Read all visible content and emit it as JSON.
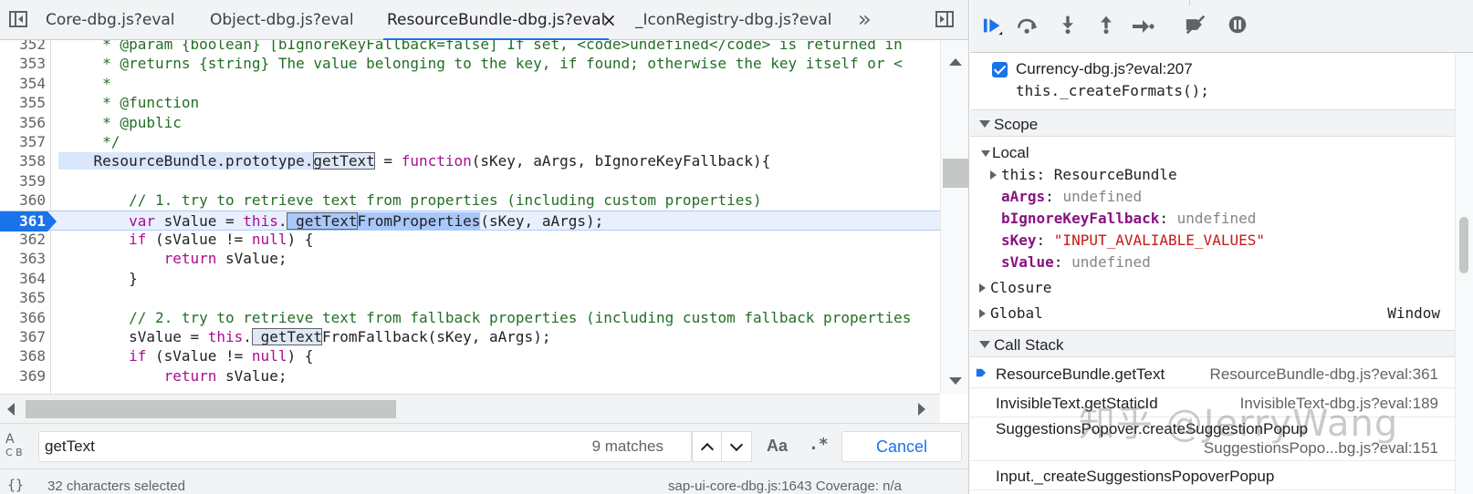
{
  "tabs": [
    {
      "label": "Core-dbg.js?eval"
    },
    {
      "label": "Object-dbg.js?eval"
    },
    {
      "label": "ResourceBundle-dbg.js?eval",
      "active": true
    },
    {
      "label": "_IconRegistry-dbg.js?eval"
    }
  ],
  "tabs_close_glyph": "×",
  "tabs_more_glyph": "»",
  "editor": {
    "current_line": 361,
    "lines": [
      {
        "n": "352",
        "text": "     * @param {boolean} [bIgnoreKeyFallback=false] If set, <code>undefined</code> is returned in"
      },
      {
        "n": "353",
        "text": "     * @returns {string} The value belonging to the key, if found; otherwise the key itself or <"
      },
      {
        "n": "354",
        "text": "     *"
      },
      {
        "n": "355",
        "text": "     * @function"
      },
      {
        "n": "356",
        "text": "     * @public"
      },
      {
        "n": "357",
        "text": "     */"
      },
      {
        "n": "358",
        "pre": "    ResourceBundle.prototype.",
        "match": "getText",
        "post": " = ",
        "kw": "function",
        "post2": "(sKey, aArgs, bIgnoreKeyFallback){"
      },
      {
        "n": "359",
        "text": ""
      },
      {
        "n": "360",
        "text": "        // 1. try to retrieve text from properties (including custom properties)"
      },
      {
        "n": "361",
        "kw": "var",
        "pre": " sValue = ",
        "kw2": "this",
        "dot": ".",
        "sel": "_getText",
        "sel2": "FromProperties",
        "post": "(sKey, aArgs);"
      },
      {
        "n": "362",
        "kw": "if",
        "pre": " (sValue != ",
        "kw2": "null",
        "post": ") {"
      },
      {
        "n": "363",
        "kw": "return",
        "post": " sValue;"
      },
      {
        "n": "364",
        "text": "        }"
      },
      {
        "n": "365",
        "text": ""
      },
      {
        "n": "366",
        "text": "        // 2. try to retrieve text from fallback properties (including custom fallback properties"
      },
      {
        "n": "367",
        "pre": "        sValue = ",
        "kw2": "this",
        "dot": ".",
        "match": "_getText",
        "post": "FromFallback(sKey, aArgs);"
      },
      {
        "n": "368",
        "kw": "if",
        "pre": " (sValue != ",
        "kw2": "null",
        "post": ") {"
      },
      {
        "n": "369",
        "kw": "return",
        "post": " sValue;"
      }
    ]
  },
  "search": {
    "value": "getText",
    "match_count": "9 matches",
    "match_case_label": "Aa",
    "regex_label": ".*",
    "cancel_label": "Cancel",
    "replace_toggle": "A",
    "replace_toggle_sub": "C B"
  },
  "status": {
    "pretty_print": "{}",
    "selection": "32 characters selected",
    "coverage": "sap-ui-core-dbg.js:1643  Coverage: n/a"
  },
  "debugger": {
    "breakpoint": {
      "checked": true,
      "location": "Currency-dbg.js?eval:207",
      "code": "this._createFormats();"
    },
    "scope": {
      "title": "Scope",
      "local_title": "Local",
      "this_label": "this: ResourceBundle",
      "vars": [
        {
          "name": "aArgs",
          "value": "undefined",
          "type": "undef"
        },
        {
          "name": "bIgnoreKeyFallback",
          "value": "undefined",
          "type": "undef"
        },
        {
          "name": "sKey",
          "value": "\"INPUT_AVALIABLE_VALUES\"",
          "type": "str"
        },
        {
          "name": "sValue",
          "value": "undefined",
          "type": "undef"
        }
      ],
      "closure": "Closure",
      "global": "Global",
      "global_value": "Window"
    },
    "callstack": {
      "title": "Call Stack",
      "frames": [
        {
          "fn": "ResourceBundle.getText",
          "loc": "ResourceBundle-dbg.js?eval:361",
          "current": true
        },
        {
          "fn": "InvisibleText.getStaticId",
          "loc": "InvisibleText-dbg.js?eval:189"
        },
        {
          "fn": "SuggestionsPopover.createSuggestionPopup",
          "loc": ""
        },
        {
          "fn": "",
          "loc": "SuggestionsPopo...bg.js?eval:151"
        },
        {
          "fn": "Input._createSuggestionsPopoverPopup",
          "loc": ""
        }
      ]
    }
  },
  "watermark": "知乎 @JerryWang",
  "colors": {
    "accent": "#1a73e8",
    "comment": "#236e25",
    "keyword": "#aa0d91",
    "string": "#c41a16"
  }
}
